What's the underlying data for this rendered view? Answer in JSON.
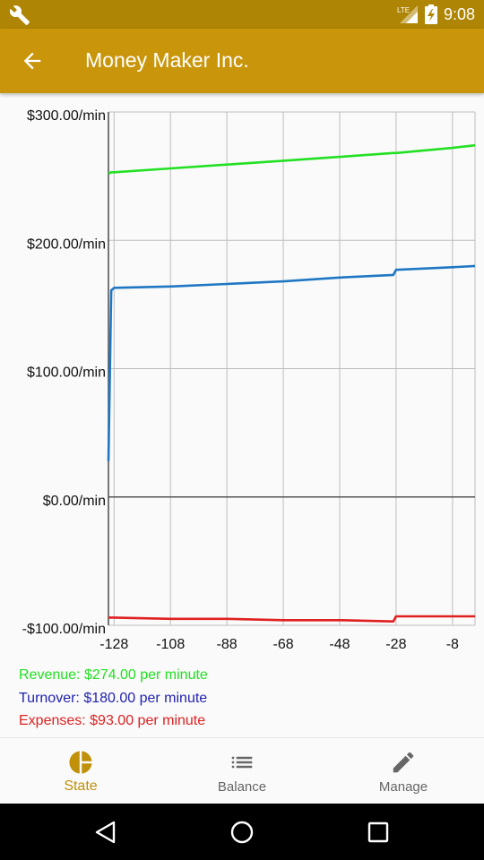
{
  "status_bar": {
    "time": "9:08",
    "network": "LTE"
  },
  "app_bar": {
    "title": "Money Maker Inc."
  },
  "chart_data": {
    "type": "line",
    "x": [
      -130,
      -129,
      -128,
      -108,
      -88,
      -68,
      -48,
      -29,
      -28,
      -8,
      0
    ],
    "x_ticks": [
      -128,
      -108,
      -88,
      -68,
      -48,
      -28,
      -8
    ],
    "x_tick_labels": [
      "-128",
      "-108",
      "-88",
      "-68",
      "-48",
      "-28",
      "-8"
    ],
    "y_ticks": [
      300,
      200,
      100,
      0,
      -100
    ],
    "y_tick_labels": [
      "$300.00/min",
      "$200.00/min",
      "$100.00/min",
      "$0.00/min",
      "-$100.00/min"
    ],
    "xlim": [
      -130,
      0
    ],
    "ylim": [
      -100,
      300
    ],
    "grid": true,
    "series": [
      {
        "color": "#22e022",
        "values": [
          252,
          253,
          253,
          256,
          259,
          262,
          265,
          268,
          268,
          272,
          274
        ]
      },
      {
        "color": "#1f77c4",
        "values": [
          28,
          161,
          163,
          164,
          166,
          168,
          171,
          173,
          177,
          179,
          180
        ]
      },
      {
        "color": "#e02020",
        "values": [
          -94,
          -94,
          -94,
          -95,
          -95,
          -96,
          -96,
          -97,
          -93,
          -93,
          -93
        ]
      }
    ]
  },
  "legend": {
    "revenue": "Revenue: $274.00 per minute",
    "turnover": "Turnover: $180.00 per minute",
    "expenses": "Expenses: $93.00 per minute",
    "colors": {
      "revenue": "#22e022",
      "turnover": "#2222b0",
      "expenses": "#e02020"
    }
  },
  "bottom_nav": {
    "items": [
      {
        "label": "State",
        "icon": "pie-chart-icon",
        "active": true
      },
      {
        "label": "Balance",
        "icon": "list-icon",
        "active": false
      },
      {
        "label": "Manage",
        "icon": "pencil-icon",
        "active": false
      }
    ],
    "active_color": "#c09008"
  }
}
